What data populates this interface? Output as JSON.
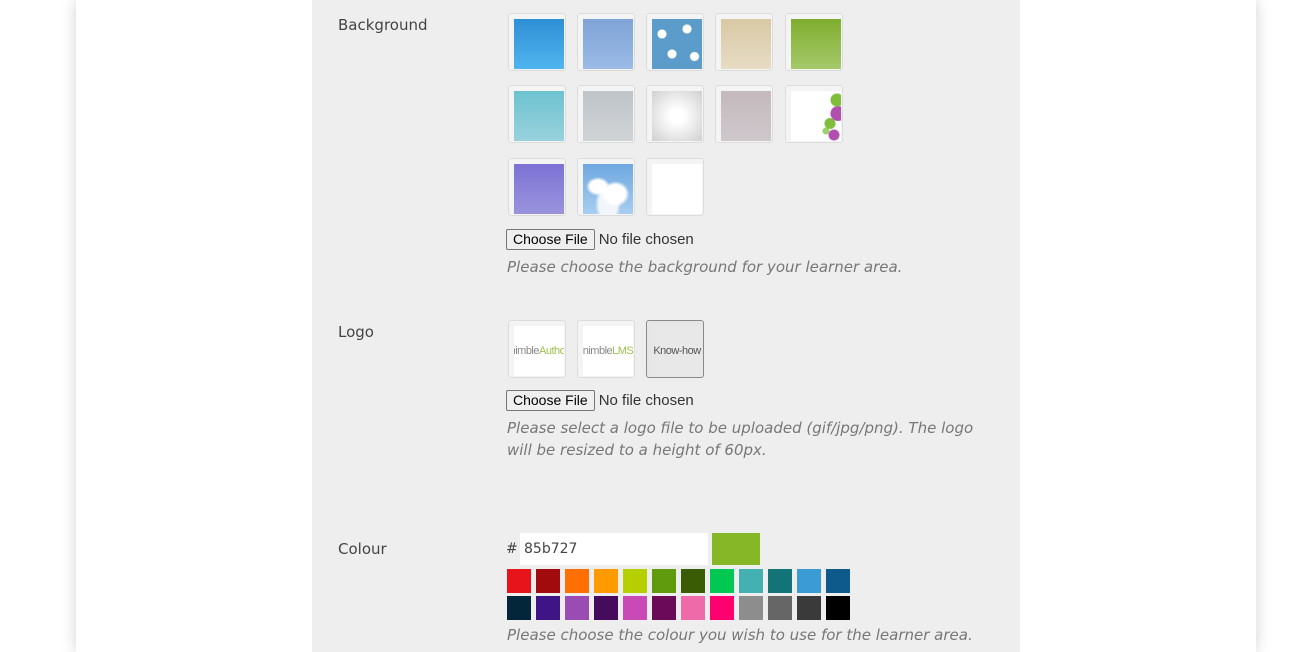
{
  "background": {
    "label": "Background",
    "swatches": [
      {
        "name": "blue-gradient"
      },
      {
        "name": "periwinkle-gradient"
      },
      {
        "name": "cloud-pattern"
      },
      {
        "name": "beige-gradient"
      },
      {
        "name": "green-gradient"
      },
      {
        "name": "teal-gradient"
      },
      {
        "name": "grey-gradient"
      },
      {
        "name": "white-radial"
      },
      {
        "name": "mauve-grey-gradient"
      },
      {
        "name": "white-with-blobs"
      },
      {
        "name": "purple-gradient"
      },
      {
        "name": "sky-clouds"
      },
      {
        "name": "plain-white"
      }
    ],
    "choose_button": "Choose File",
    "file_status": "No file chosen",
    "help": "Please choose the background for your learner area."
  },
  "logo": {
    "label": "Logo",
    "options": [
      {
        "part1": "nimble",
        "part2": "Author"
      },
      {
        "part1": "nimble",
        "part2": "LMS"
      },
      {
        "part1": "",
        "part2": "Know-how"
      }
    ],
    "choose_button": "Choose File",
    "file_status": "No file chosen",
    "help": "Please select a logo file to be uploaded (gif/jpg/png). The logo will be resized to a height of 60px."
  },
  "colour": {
    "label": "Colour",
    "hash": "#",
    "value": "85b727",
    "preview_color": "#85b727",
    "palette": [
      "#e8141b",
      "#a20b0e",
      "#ff7004",
      "#ff9a00",
      "#b5cf00",
      "#5f9b0d",
      "#3a5c05",
      "#00c853",
      "#43b1b1",
      "#137477",
      "#3b9bd4",
      "#0e5a8a",
      "#03263b",
      "#3f1485",
      "#9b4bb4",
      "#450c5e",
      "#c949b6",
      "#6b0a56",
      "#ef6aa8",
      "#ff006e",
      "#8d8d8d",
      "#666666",
      "#3a3a3a",
      "#000000"
    ],
    "help": "Please choose the colour you wish to use for the learner area."
  }
}
